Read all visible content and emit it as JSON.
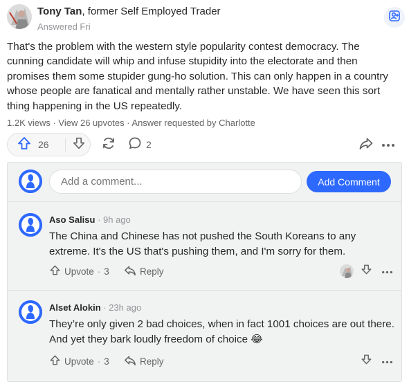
{
  "answer": {
    "author_name": "Tony Tan",
    "author_credential": ", former Self Employed Trader",
    "answered": "Answered Fri",
    "text": "That's the problem with the western style popularity contest democracy. The cunning candidate will whip and infuse stupidity into the electorate and then promises them some stupider gung-ho solution. This can only happen in a country whose people are fanatical and mentally rather unstable. We have seen this sort thing happening in the US repeatedly.",
    "stats": "1.2K views · View 26 upvotes · Answer requested by Charlotte",
    "upvotes": "26",
    "comments_count": "2",
    "icons": {
      "request": "request-answer-icon",
      "upvote": "upvote-arrow-icon",
      "downvote": "downvote-arrow-icon",
      "share": "reshare-icon",
      "comment": "comment-bubble-icon",
      "send": "share-arrow-icon",
      "more": "more-options-icon"
    }
  },
  "add_comment": {
    "placeholder": "Add a comment...",
    "button_label": "Add Comment"
  },
  "comments": [
    {
      "author": "Aso Salisu",
      "time": " · 9h ago",
      "text": "The China and Chinese has not pushed the South Koreans to any extreme. It's the US that's pushing them, and I'm sorry for them.",
      "upvote_label": "Upvote",
      "upvote_count": "3",
      "reply_label": "Reply"
    },
    {
      "author": "Alset Alokin",
      "time": " · 23h ago",
      "text": "They’re only given 2 bad choices, when in fact 1001 choices are out there. And yet they bark loudly freedom of choice",
      "emoji": "😂",
      "upvote_label": "Upvote",
      "upvote_count": "3",
      "reply_label": "Reply"
    }
  ],
  "colors": {
    "accent": "#2e69ff",
    "text": "#282829",
    "secondary": "#636466",
    "muted": "#939598",
    "panel": "#f1f2f2",
    "border": "#dee0e1"
  }
}
